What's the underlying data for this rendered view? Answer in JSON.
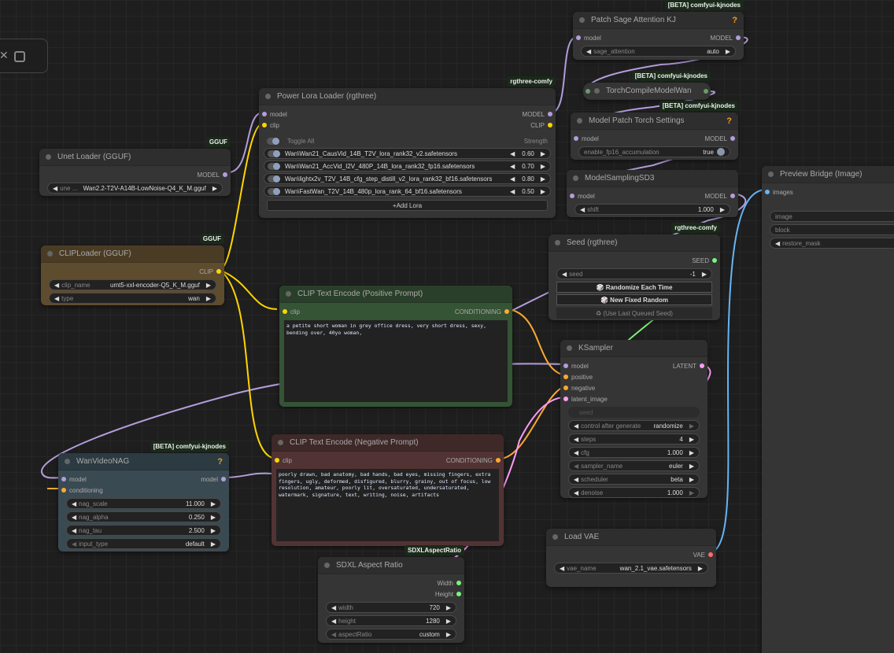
{
  "slot_colors": {
    "model": "#b39ddb",
    "clip": "#ffd500",
    "conditioning": "#ffa931",
    "latent": "#ff9cf9",
    "image": "#64b5f6",
    "vae": "#ff6e6e",
    "int": "#7cf47a"
  },
  "nodes": [
    {
      "id": "unet",
      "title": "Unet Loader (GGUF)",
      "badge": "GGUF",
      "outputs": [
        {
          "label": "MODEL",
          "type": "model"
        }
      ],
      "widgets": [
        {
          "kind": "combo",
          "label": "une ...",
          "value": "Wan2.2-T2V-A14B-LowNoise-Q4_K_M.gguf"
        }
      ]
    },
    {
      "id": "lora",
      "title": "Power Lora Loader (rgthree)",
      "badge": "rgthree-comfy",
      "inputs": [
        {
          "label": "model",
          "type": "model"
        },
        {
          "label": "clip",
          "type": "clip"
        }
      ],
      "outputs": [
        {
          "label": "MODEL",
          "type": "model"
        },
        {
          "label": "CLIP",
          "type": "clip"
        }
      ],
      "toggle_all": "Toggle All",
      "strength_label": "Strength",
      "loras": [
        {
          "name": "Wan\\Wan21_CausVid_14B_T2V_lora_rank32_v2.safetensors",
          "strength": "0.60"
        },
        {
          "name": "Wan\\Wan21_AccVid_I2V_480P_14B_lora_rank32_fp16.safetensors",
          "strength": "0.70"
        },
        {
          "name": "Wan\\lightx2v_T2V_14B_cfg_step_distill_v2_lora_rank32_bf16.safetensors",
          "strength": "0.80"
        },
        {
          "name": "Wan\\FastWan_T2V_14B_480p_lora_rank_64_bf16.safetensors",
          "strength": "0.50"
        }
      ],
      "add_lora": "Add Lora"
    },
    {
      "id": "sage",
      "title": "Patch Sage Attention KJ",
      "badge": "[BETA] comfyui-kjnodes",
      "help": "?",
      "inputs": [
        {
          "label": "model",
          "type": "model"
        }
      ],
      "outputs": [
        {
          "label": "MODEL",
          "type": "model"
        }
      ],
      "widgets": [
        {
          "kind": "combo",
          "label": "sage_attention",
          "value": "auto"
        }
      ]
    },
    {
      "id": "torch",
      "title": "TorchCompileModelWan",
      "badge": "[BETA] comfyui-kjnodes",
      "collapsed": true
    },
    {
      "id": "mpts",
      "title": "Model Patch Torch Settings",
      "badge": "[BETA] comfyui-kjnodes",
      "help": "?",
      "inputs": [
        {
          "label": "model",
          "type": "model"
        }
      ],
      "outputs": [
        {
          "label": "MODEL",
          "type": "model"
        }
      ],
      "widgets": [
        {
          "kind": "toggle",
          "label": "enable_fp16_accumulation",
          "value": "true"
        }
      ]
    },
    {
      "id": "msd3",
      "title": "ModelSamplingSD3",
      "inputs": [
        {
          "label": "model",
          "type": "model"
        }
      ],
      "outputs": [
        {
          "label": "MODEL",
          "type": "model"
        }
      ],
      "widgets": [
        {
          "kind": "number",
          "label": "shift",
          "value": "1.000"
        }
      ]
    },
    {
      "id": "preview",
      "title": "Preview Bridge (Image)",
      "inputs": [
        {
          "label": "images",
          "type": "image"
        }
      ],
      "widgets": [
        {
          "kind": "text",
          "label": "image"
        },
        {
          "kind": "text",
          "label": "block"
        },
        {
          "kind": "combo-l",
          "label": "restore_mask"
        }
      ]
    },
    {
      "id": "seed",
      "title": "Seed (rgthree)",
      "badge": "rgthree-comfy",
      "outputs": [
        {
          "label": "SEED",
          "type": "int"
        }
      ],
      "widgets": [
        {
          "kind": "number",
          "label": "seed",
          "value": "-1"
        },
        {
          "kind": "button",
          "label": "🎲 Randomize Each Time"
        },
        {
          "kind": "button",
          "label": "🎲 New Fixed Random"
        },
        {
          "kind": "ghost",
          "label": "♻ (Use Last Queued Seed)"
        }
      ]
    },
    {
      "id": "ks",
      "title": "KSampler",
      "inputs": [
        {
          "label": "model",
          "type": "model"
        },
        {
          "label": "positive",
          "type": "conditioning"
        },
        {
          "label": "negative",
          "type": "conditioning"
        },
        {
          "label": "latent_image",
          "type": "latent"
        }
      ],
      "outputs": [
        {
          "label": "LATENT",
          "type": "latent"
        }
      ],
      "widgets": [
        {
          "kind": "slot",
          "label": "seed"
        },
        {
          "kind": "combo",
          "label": "control after generate",
          "value": "randomize",
          "dis_r": true
        },
        {
          "kind": "number",
          "label": "steps",
          "value": "4"
        },
        {
          "kind": "number",
          "label": "cfg",
          "value": "1.000"
        },
        {
          "kind": "combo",
          "label": "sampler_name",
          "value": "euler",
          "dis_l": true
        },
        {
          "kind": "combo",
          "label": "scheduler",
          "value": "beta"
        },
        {
          "kind": "number",
          "label": "denoise",
          "value": "1.000",
          "dis_r": true
        }
      ]
    },
    {
      "id": "clip",
      "title": "CLIPLoader (GGUF)",
      "badge": "GGUF",
      "theme": {
        "hdr": "#4a3c24",
        "body": "#5e4c2e"
      },
      "outputs": [
        {
          "label": "CLIP",
          "type": "clip"
        }
      ],
      "widgets": [
        {
          "kind": "combo",
          "label": "clip_name",
          "value": "umt5-xxl-encoder-Q5_K_M.gguf"
        },
        {
          "kind": "combo",
          "label": "type",
          "value": "wan"
        }
      ]
    },
    {
      "id": "pos",
      "title": "CLIP Text Encode (Positive Prompt)",
      "theme": {
        "hdr": "#2a3f2a",
        "body": "#355335"
      },
      "inputs": [
        {
          "label": "clip",
          "type": "clip"
        }
      ],
      "outputs": [
        {
          "label": "CONDITIONING",
          "type": "conditioning"
        }
      ],
      "text": "a petite short woman in grey office dress, very short dress, sexy,\nbending over, 40yo woman,"
    },
    {
      "id": "neg",
      "title": "CLIP Text Encode (Negative Prompt)",
      "theme": {
        "hdr": "#3e2828",
        "body": "#523333"
      },
      "inputs": [
        {
          "label": "clip",
          "type": "clip"
        }
      ],
      "outputs": [
        {
          "label": "CONDITIONING",
          "type": "conditioning"
        }
      ],
      "text": "poorly drawn, bad anatomy, bad hands, bad eyes, missing fingers, extra\nfingers, ugly, deformed, disfigured, blurry, grainy, out of focus, low\nresolution, amateur, poorly lit, oversaturated, undersaturated,\nwatermark, signature, text, writing, noise, artifacts"
    },
    {
      "id": "nag",
      "title": "WanVideoNAG",
      "badge": "[BETA] comfyui-kjnodes",
      "help": "?",
      "theme": {
        "hdr": "#2c3a42",
        "body": "#3a4a52"
      },
      "inputs": [
        {
          "label": "model",
          "type": "model"
        },
        {
          "label": "conditioning",
          "type": "conditioning"
        }
      ],
      "outputs": [
        {
          "label": "model",
          "type": "model"
        }
      ],
      "widgets": [
        {
          "kind": "number",
          "label": "nag_scale",
          "value": "11.000"
        },
        {
          "kind": "number",
          "label": "nag_alpha",
          "value": "0.250"
        },
        {
          "kind": "number",
          "label": "nag_tau",
          "value": "2.500"
        },
        {
          "kind": "combo",
          "label": "input_type",
          "value": "default",
          "dis_l": true
        }
      ]
    },
    {
      "id": "sdxl",
      "title": "SDXL Aspect Ratio",
      "badge": "SDXLAspectRatio",
      "outputs": [
        {
          "label": "Width",
          "type": "int"
        },
        {
          "label": "Height",
          "type": "int"
        }
      ],
      "widgets": [
        {
          "kind": "number",
          "label": "width",
          "value": "720"
        },
        {
          "kind": "number",
          "label": "height",
          "value": "1280"
        },
        {
          "kind": "combo",
          "label": "aspectRatio",
          "value": "custom",
          "dis_l": true
        }
      ]
    },
    {
      "id": "vae",
      "title": "Load VAE",
      "outputs": [
        {
          "label": "VAE",
          "type": "vae"
        }
      ],
      "widgets": [
        {
          "kind": "combo",
          "label": "vae_name",
          "value": "wan_2.1_vae.safetensors"
        }
      ]
    }
  ]
}
